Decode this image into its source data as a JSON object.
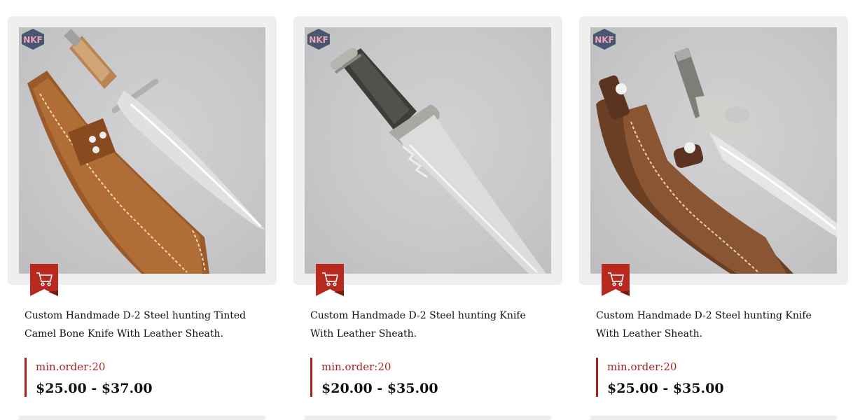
{
  "products": [
    {
      "title": "Custom Handmade D-2 Steel hunting Tinted Camel Bone Knife With Leather Sheath.",
      "min_order": "min.order:20",
      "price": "$25.00 - $37.00",
      "logo_icon": "nkf-logo-icon",
      "cart_icon": "shopping-cart-icon"
    },
    {
      "title": "Custom Handmade D-2 Steel hunting Knife With Leather Sheath.",
      "min_order": "min.order:20",
      "price": "$20.00 - $35.00",
      "logo_icon": "nkf-logo-icon",
      "cart_icon": "shopping-cart-icon"
    },
    {
      "title": "Custom Handmade D-2 Steel hunting Knife With Leather Sheath.",
      "min_order": "min.order:20",
      "price": "$25.00 - $35.00",
      "logo_icon": "nkf-logo-icon",
      "cart_icon": "shopping-cart-icon"
    }
  ],
  "colors": {
    "accent": "#a8231d",
    "frame": "#efefef",
    "photo_bg": "#c9c9cb"
  }
}
